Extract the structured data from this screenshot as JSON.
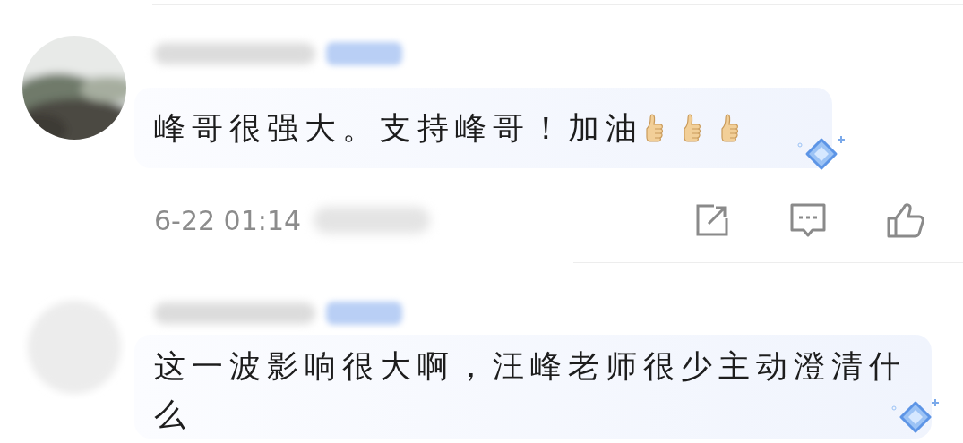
{
  "comments": [
    {
      "text": "峰哥很强大。支持峰哥！加油",
      "emoji": [
        {
          "kind": "thumbs-up"
        },
        {
          "kind": "thumbs-up"
        },
        {
          "kind": "thumbs-up"
        }
      ],
      "decoration": true,
      "time": "6-22 01:14",
      "actions": [
        {
          "kind": "share"
        },
        {
          "kind": "comment"
        },
        {
          "kind": "like"
        }
      ]
    },
    {
      "avatar": {
        "kind": "placeholder"
      },
      "text": "这一波影响很大啊，汪峰老师很少主动澄清什么",
      "decoration": true
    }
  ]
}
